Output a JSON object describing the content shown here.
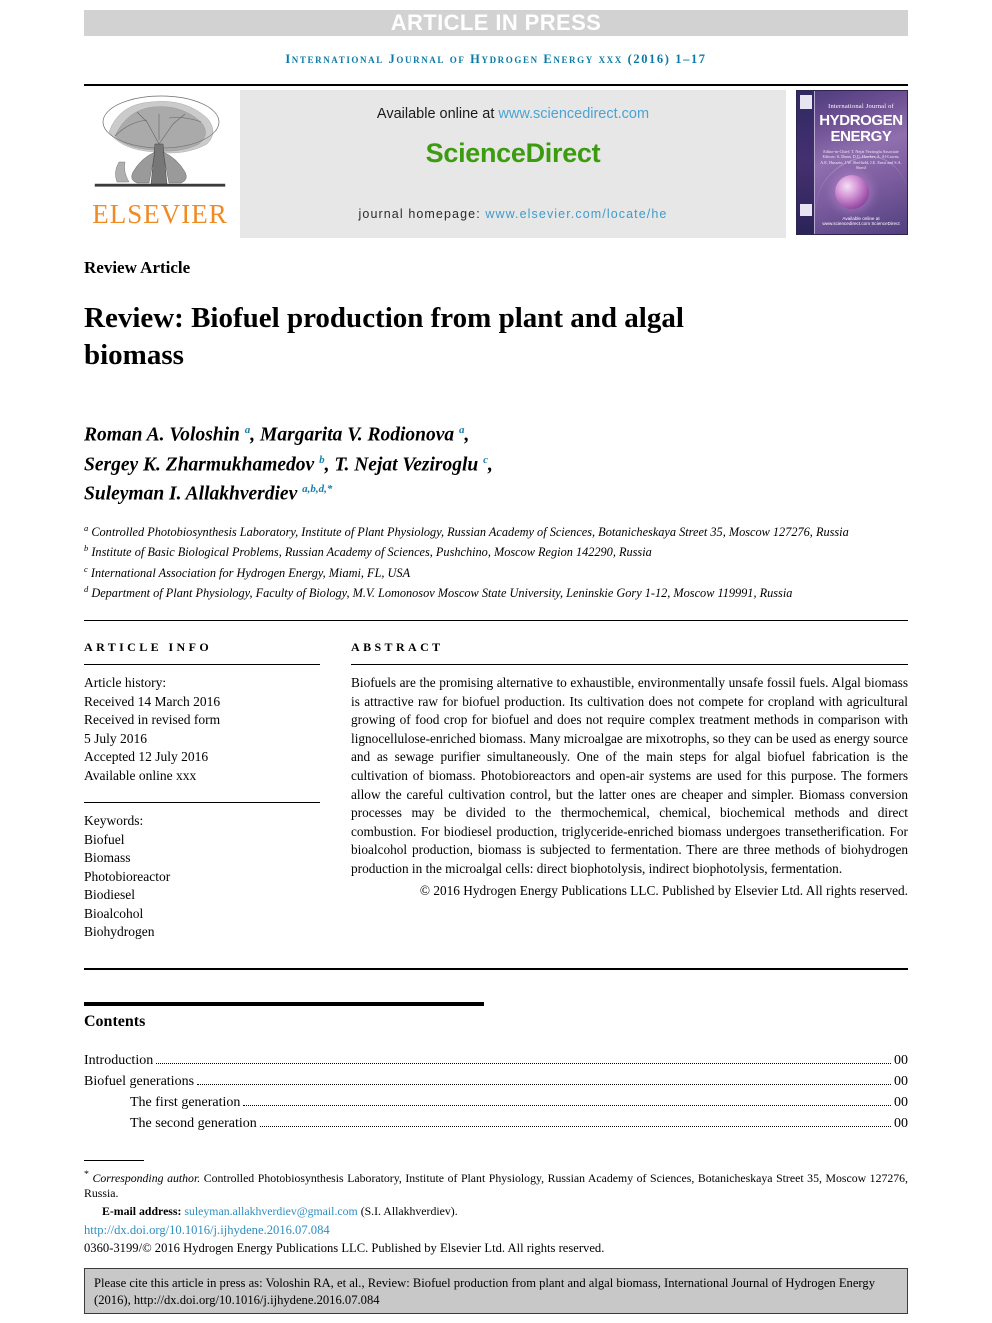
{
  "banner": {
    "article_in_press": "ARTICLE IN PRESS",
    "running_head": "International Journal of Hydrogen Energy xxx (2016) 1–17"
  },
  "masthead": {
    "publisher_wordmark": "ELSEVIER",
    "available_prefix": "Available online at ",
    "available_url": "www.sciencedirect.com",
    "sciencedirect_logo": "ScienceDirect",
    "homepage_prefix": "journal homepage: ",
    "homepage_url": "www.elsevier.com/locate/he",
    "cover": {
      "small_title": "International Journal of",
      "big_title_line1": "HYDROGEN",
      "big_title_line2": "ENERGY",
      "editors": "Editor-in-Chief: T. Nejat Veziroglu    Associate Editors: S. Dunn, D.G. Hawker, A. Al-Lawea, A.E. Hussein, J.W. Sheffield, I.E. Ernst and S.A. Sherif",
      "sciencedirect_footer": "Available online at www.sciencedirect.com  ScienceDirect"
    }
  },
  "article": {
    "type_label": "Review Article",
    "title": "Review: Biofuel production from plant and algal biomass",
    "authors_lines": [
      "Roman A. Voloshin a, Margarita V. Rodionova a,",
      "Sergey K. Zharmukhamedov b, T. Nejat Veziroglu c,",
      "Suleyman I. Allakhverdiev a,b,d,*"
    ],
    "affiliations": [
      "a Controlled Photobiosynthesis Laboratory, Institute of Plant Physiology, Russian Academy of Sciences, Botanicheskaya Street 35, Moscow 127276, Russia",
      "b Institute of Basic Biological Problems, Russian Academy of Sciences, Pushchino, Moscow Region 142290, Russia",
      "c International Association for Hydrogen Energy, Miami, FL, USA",
      "d Department of Plant Physiology, Faculty of Biology, M.V. Lomonosov Moscow State University, Leninskie Gory 1-12, Moscow 119991, Russia"
    ]
  },
  "article_info": {
    "heading": "ARTICLE INFO",
    "history_label": "Article history:",
    "history": [
      "Received 14 March 2016",
      "Received in revised form",
      "5 July 2016",
      "Accepted 12 July 2016",
      "Available online xxx"
    ],
    "keywords_label": "Keywords:",
    "keywords": [
      "Biofuel",
      "Biomass",
      "Photobioreactor",
      "Biodiesel",
      "Bioalcohol",
      "Biohydrogen"
    ]
  },
  "abstract": {
    "heading": "ABSTRACT",
    "body": "Biofuels are the promising alternative to exhaustible, environmentally unsafe fossil fuels. Algal biomass is attractive raw for biofuel production. Its cultivation does not compete for cropland with agricultural growing of food crop for biofuel and does not require complex treatment methods in comparison with lignocellulose-enriched biomass. Many microalgae are mixotrophs, so they can be used as energy source and as sewage purifier simultaneously. One of the main steps for algal biofuel fabrication is the cultivation of biomass. Photobioreactors and open-air systems are used for this purpose. The formers allow the careful cultivation control, but the latter ones are cheaper and simpler. Biomass conversion processes may be divided to the thermochemical, chemical, biochemical methods and direct combustion. For biodiesel production, triglyceride-enriched biomass undergoes transetherification. For bioalcohol production, biomass is subjected to fermentation. There are three methods of biohydrogen production in the microalgal cells: direct biophotolysis, indirect biophotolysis, fermentation.",
    "copyright": "© 2016 Hydrogen Energy Publications LLC. Published by Elsevier Ltd. All rights reserved."
  },
  "contents": {
    "heading": "Contents",
    "entries": [
      {
        "label": "Introduction",
        "page": "00",
        "indent": false
      },
      {
        "label": "Biofuel generations",
        "page": "00",
        "indent": false
      },
      {
        "label": "The first generation",
        "page": "00",
        "indent": true
      },
      {
        "label": "The second generation",
        "page": "00",
        "indent": true
      }
    ]
  },
  "footnotes": {
    "corresponding_marker": "*",
    "corresponding_label": "Corresponding author.",
    "corresponding_address": " Controlled Photobiosynthesis Laboratory, Institute of Plant Physiology, Russian Academy of Sciences, Botanicheskaya Street 35, Moscow 127276, Russia.",
    "email_label": "E-mail address:",
    "email": "suleyman.allakhverdiev@gmail.com",
    "email_owner": "(S.I. Allakhverdiev).",
    "doi": "http://dx.doi.org/10.1016/j.ijhydene.2016.07.084",
    "issn_line": "0360-3199/© 2016 Hydrogen Energy Publications LLC. Published by Elsevier Ltd. All rights reserved."
  },
  "citation_box": {
    "text": "Please cite this article in press as: Voloshin RA, et al., Review: Biofuel production from plant and algal biomass, International Journal of Hydrogen Energy (2016), http://dx.doi.org/10.1016/j.ijhydene.2016.07.084"
  },
  "colors": {
    "banner_bg": "#d2d2d2",
    "running_head": "#0b7ba5",
    "elsevier_orange": "#f08a23",
    "sciencedirect_green": "#3c9b0f",
    "link_blue": "#2e8fc0",
    "superscript_blue": "#1b7fa8",
    "panel_grey": "#e7e7e7",
    "citation_grey": "#c8c8c8"
  }
}
